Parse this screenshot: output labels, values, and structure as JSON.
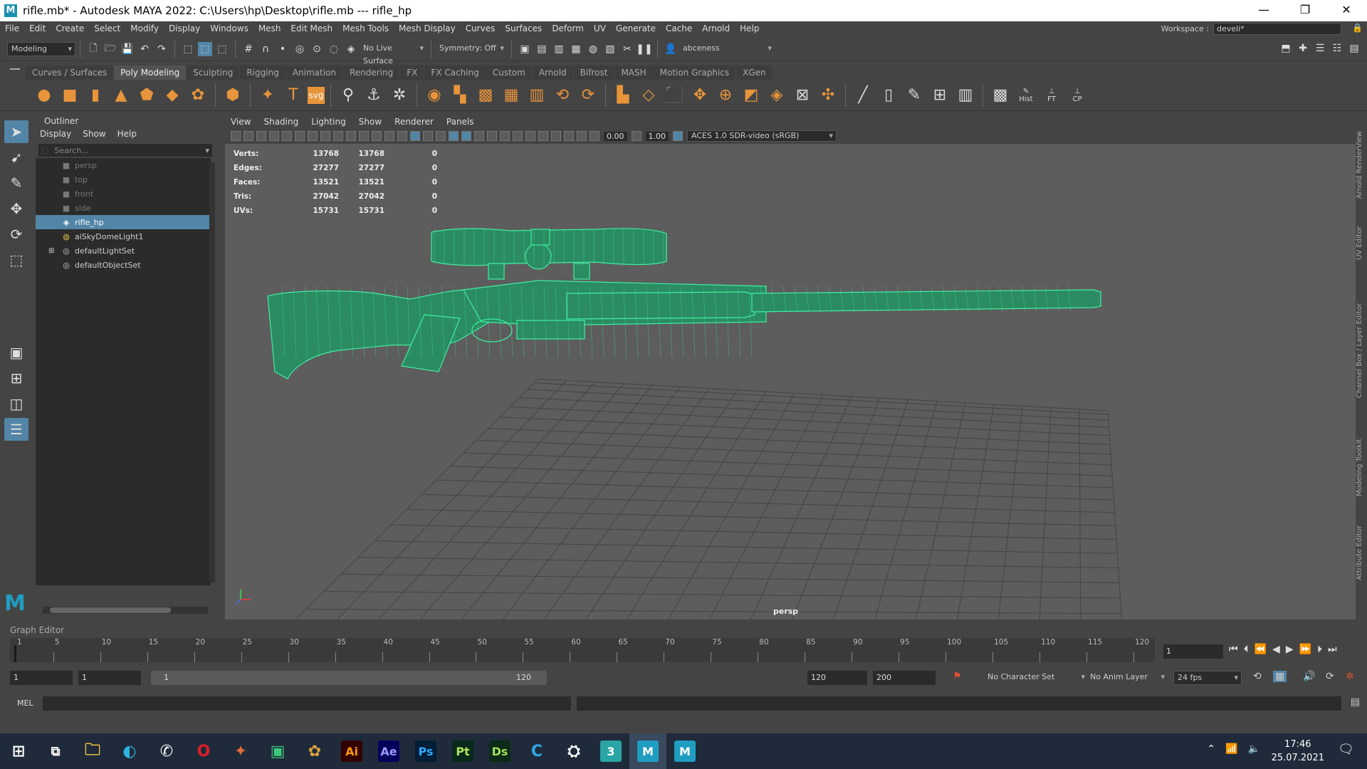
{
  "window": {
    "title": "rifle.mb* - Autodesk MAYA 2022: C:\\Users\\hp\\Desktop\\rifle.mb   ---   rifle_hp"
  },
  "menubar": {
    "items": [
      "File",
      "Edit",
      "Create",
      "Select",
      "Modify",
      "Display",
      "Windows",
      "Mesh",
      "Edit Mesh",
      "Mesh Tools",
      "Mesh Display",
      "Curves",
      "Surfaces",
      "Deform",
      "UV",
      "Generate",
      "Cache",
      "Arnold",
      "Help"
    ],
    "workspace_label": "Workspace :",
    "workspace_value": "develi*"
  },
  "statusline": {
    "mode": "Modeling",
    "live_surface": "No Live Surface",
    "symmetry": "Symmetry: Off",
    "user": "abceness"
  },
  "shelf": {
    "tabs": [
      "Curves / Surfaces",
      "Poly Modeling",
      "Sculpting",
      "Rigging",
      "Animation",
      "Rendering",
      "FX",
      "FX Caching",
      "Custom",
      "Arnold",
      "Bifrost",
      "MASH",
      "Motion Graphics",
      "XGen"
    ],
    "active_tab": "Poly Modeling",
    "hist_label": "Hist",
    "ft_label": "FT",
    "cp_label": "CP"
  },
  "outliner": {
    "title": "Outliner",
    "menu": [
      "Display",
      "Show",
      "Help"
    ],
    "search_placeholder": "Search...",
    "items": [
      {
        "label": "persp",
        "icon": "camera-icon",
        "dim": true
      },
      {
        "label": "top",
        "icon": "camera-icon",
        "dim": true
      },
      {
        "label": "front",
        "icon": "camera-icon",
        "dim": true
      },
      {
        "label": "side",
        "icon": "camera-icon",
        "dim": true
      },
      {
        "label": "rifle_hp",
        "icon": "mesh-icon",
        "selected": true
      },
      {
        "label": "aiSkyDomeLight1",
        "icon": "light-icon"
      },
      {
        "label": "defaultLightSet",
        "icon": "set-icon",
        "expandable": true
      },
      {
        "label": "defaultObjectSet",
        "icon": "set-icon"
      }
    ]
  },
  "viewport": {
    "menu": [
      "View",
      "Shading",
      "Lighting",
      "Show",
      "Renderer",
      "Panels"
    ],
    "exposure": "0.00",
    "gamma": "1.00",
    "colorspace": "ACES 1.0 SDR-video (sRGB)",
    "camera_label": "persp",
    "hud": [
      {
        "label": "Verts:",
        "a": "13768",
        "b": "13768",
        "c": "0"
      },
      {
        "label": "Edges:",
        "a": "27277",
        "b": "27277",
        "c": "0"
      },
      {
        "label": "Faces:",
        "a": "13521",
        "b": "13521",
        "c": "0"
      },
      {
        "label": "Tris:",
        "a": "27042",
        "b": "27042",
        "c": "0"
      },
      {
        "label": "UVs:",
        "a": "15731",
        "b": "15731",
        "c": "0"
      }
    ],
    "wire_color": "#3ef0a0"
  },
  "right_tabs": [
    "Arnold RenderView",
    "UV Editor",
    "Channel Box / Layer Editor",
    "Modeling Toolkit",
    "Attribute Editor"
  ],
  "timeline": {
    "graph_editor_label": "Graph Editor",
    "ticks": [
      "1",
      "5",
      "10",
      "15",
      "20",
      "25",
      "30",
      "35",
      "40",
      "45",
      "50",
      "55",
      "60",
      "65",
      "70",
      "75",
      "80",
      "85",
      "90",
      "95",
      "100",
      "105",
      "110",
      "115",
      "120"
    ],
    "current_frame": "1"
  },
  "range": {
    "start": "1",
    "playback_start": "1",
    "slider_start": "1",
    "slider_end": "120",
    "playback_end": "120",
    "end": "200",
    "character_set": "No Character Set",
    "anim_layer": "No Anim Layer",
    "fps": "24 fps"
  },
  "cmdline": {
    "label": "MEL"
  },
  "taskbar": {
    "apps": [
      "Ai",
      "Ae",
      "Ps",
      "Pt",
      "Ds"
    ],
    "time": "17:46",
    "date": "25.07.2021"
  }
}
